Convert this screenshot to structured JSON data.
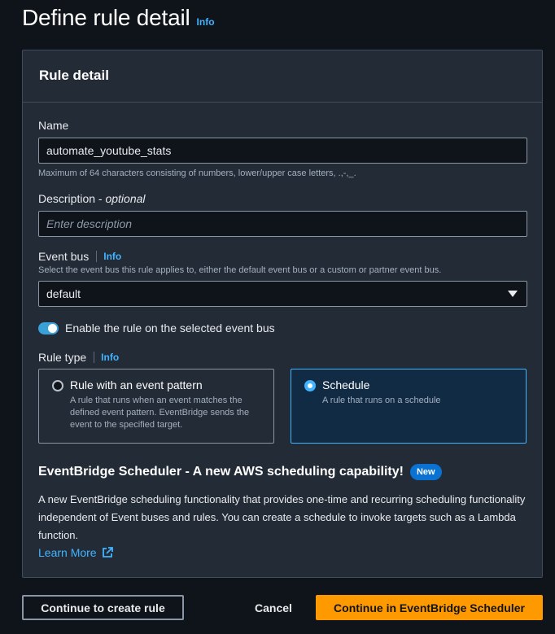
{
  "header": {
    "title": "Define rule detail",
    "info": "Info"
  },
  "panel": {
    "title": "Rule detail",
    "name": {
      "label": "Name",
      "value": "automate_youtube_stats",
      "hint": "Maximum of 64 characters consisting of numbers, lower/upper case letters, .,-,_."
    },
    "description": {
      "label": "Description - ",
      "optional": "optional",
      "placeholder": "Enter description"
    },
    "event_bus": {
      "label": "Event bus",
      "info": "Info",
      "hint": "Select the event bus this rule applies to, either the default event bus or a custom or partner event bus.",
      "value": "default"
    },
    "toggle": {
      "label": "Enable the rule on the selected event bus",
      "enabled": true
    },
    "rule_type": {
      "label": "Rule type",
      "info": "Info",
      "options": [
        {
          "title": "Rule with an event pattern",
          "desc": "A rule that runs when an event matches the defined event pattern. EventBridge sends the event to the specified target.",
          "selected": false
        },
        {
          "title": "Schedule",
          "desc": "A rule that runs on a schedule",
          "selected": true
        }
      ]
    },
    "scheduler": {
      "title": "EventBridge Scheduler - A new AWS scheduling capability!",
      "badge": "New",
      "text": "A new EventBridge scheduling functionality that provides one-time and recurring scheduling functionality independent of Event buses and rules. You can create a schedule to invoke targets such as a Lambda function.",
      "link": "Learn More"
    }
  },
  "footer": {
    "continue_rule": "Continue to create rule",
    "cancel": "Cancel",
    "continue_scheduler": "Continue in EventBridge Scheduler"
  },
  "colors": {
    "accent": "#42b4ff",
    "primary_button": "#ff9900",
    "badge": "#0972d3"
  }
}
